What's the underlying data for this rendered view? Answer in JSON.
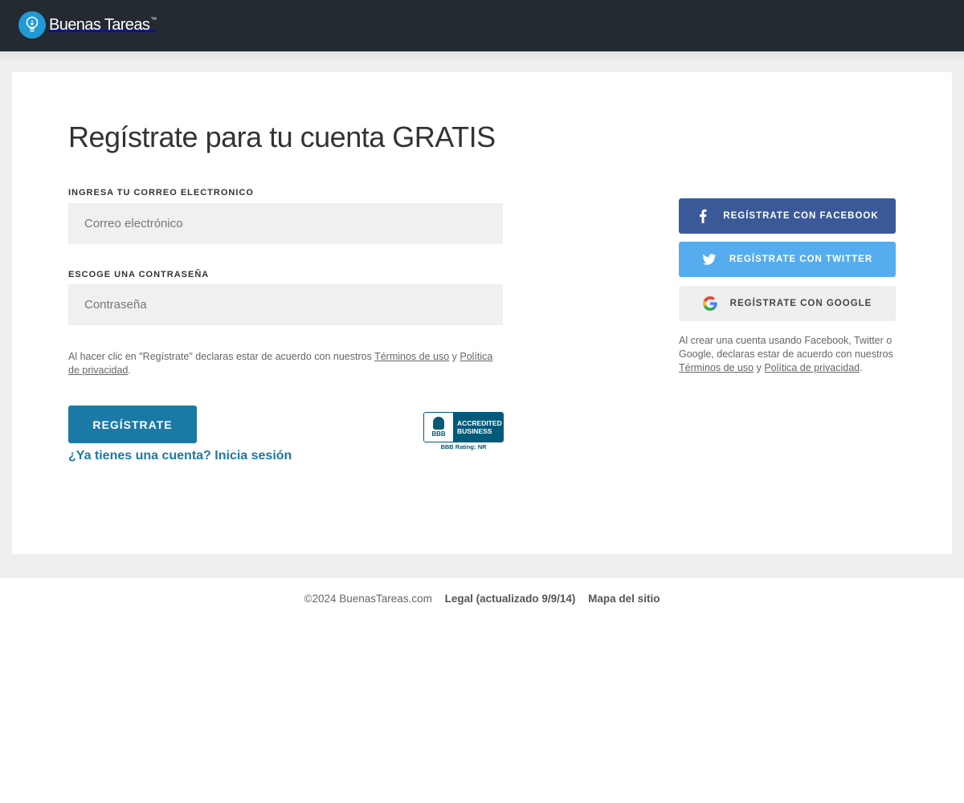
{
  "header": {
    "logo_text": "Buenas Tareas",
    "logo_mark": "™"
  },
  "form": {
    "title": "Regístrate para tu cuenta GRATIS",
    "email_label": "INGRESA TU CORREO ELECTRONICO",
    "email_placeholder": "Correo electrónico",
    "email_value": "",
    "password_label": "ESCOGE UNA CONTRASEÑA",
    "password_placeholder": "Contraseña",
    "password_value": "",
    "terms_prefix": "Al hacer clic en \"Regístrate\" declaras estar de acuerdo con nuestros ",
    "terms_link": "Términos de uso",
    "terms_and": " y ",
    "privacy_link": "Política de privacidad",
    "terms_suffix": ".",
    "submit_label": "REGÍSTRATE",
    "login_link": "¿Ya tienes una cuenta? Inicia sesión"
  },
  "bbb": {
    "letters": "BBB",
    "line1": "ACCREDITED",
    "line2": "BUSINESS",
    "rating": "BBB Rating: NR",
    "color": "#005a78"
  },
  "social": {
    "facebook_label": "REGÍSTRATE CON FACEBOOK",
    "facebook_icon": "facebook-icon",
    "twitter_label": "REGÍSTRATE CON TWITTER",
    "twitter_icon": "twitter-icon",
    "google_label": "REGÍSTRATE CON GOOGLE",
    "google_icon": "google-icon",
    "terms_prefix": "Al crear una cuenta usando Facebook, Twitter o Google, declaras estar de acuerdo con nuestros ",
    "terms_link": "Términos de uso",
    "terms_and": " y ",
    "privacy_link": "Política de privacidad",
    "terms_suffix": "."
  },
  "footer": {
    "copyright": "©2024 BuenasTareas.com",
    "legal": "Legal (actualizado 9/9/14)",
    "sitemap": "Mapa del sitio"
  },
  "colors": {
    "header_bg": "#232a31",
    "primary": "#1b7aa5",
    "facebook": "#3b5998",
    "twitter": "#55acee",
    "logo": "#1f9ad6"
  }
}
